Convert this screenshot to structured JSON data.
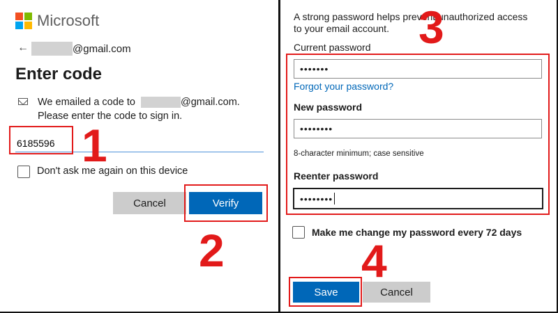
{
  "left": {
    "brand": "Microsoft",
    "email_suffix": "@gmail.com",
    "title": "Enter code",
    "message_line1_prefix": "We emailed a code to",
    "message_line1_suffix": "@gmail.com.",
    "message_line2": "Please enter the code to sign in.",
    "code_value": "6185596",
    "dont_ask_label": "Don't ask me again on this device",
    "cancel_label": "Cancel",
    "verify_label": "Verify",
    "logo_colors": [
      "#f25022",
      "#7fba00",
      "#00a4ef",
      "#ffb900"
    ]
  },
  "right": {
    "intro_line1": "A strong password helps prevent unauthorized access",
    "intro_line2": "to your email account.",
    "current_password_label": "Current password",
    "current_password_value": "•••••••",
    "forgot_link": "Forgot your password?",
    "new_password_label": "New password",
    "new_password_value": "••••••••",
    "hint": "8-character minimum; case sensitive",
    "reenter_label": "Reenter password",
    "reenter_value": "••••••••",
    "change_every_label": "Make me change my password every 72 days",
    "save_label": "Save",
    "cancel_label": "Cancel"
  },
  "annotations": {
    "step1": "1",
    "step2": "2",
    "step3": "3",
    "step4": "4",
    "color": "#e21a1a"
  }
}
